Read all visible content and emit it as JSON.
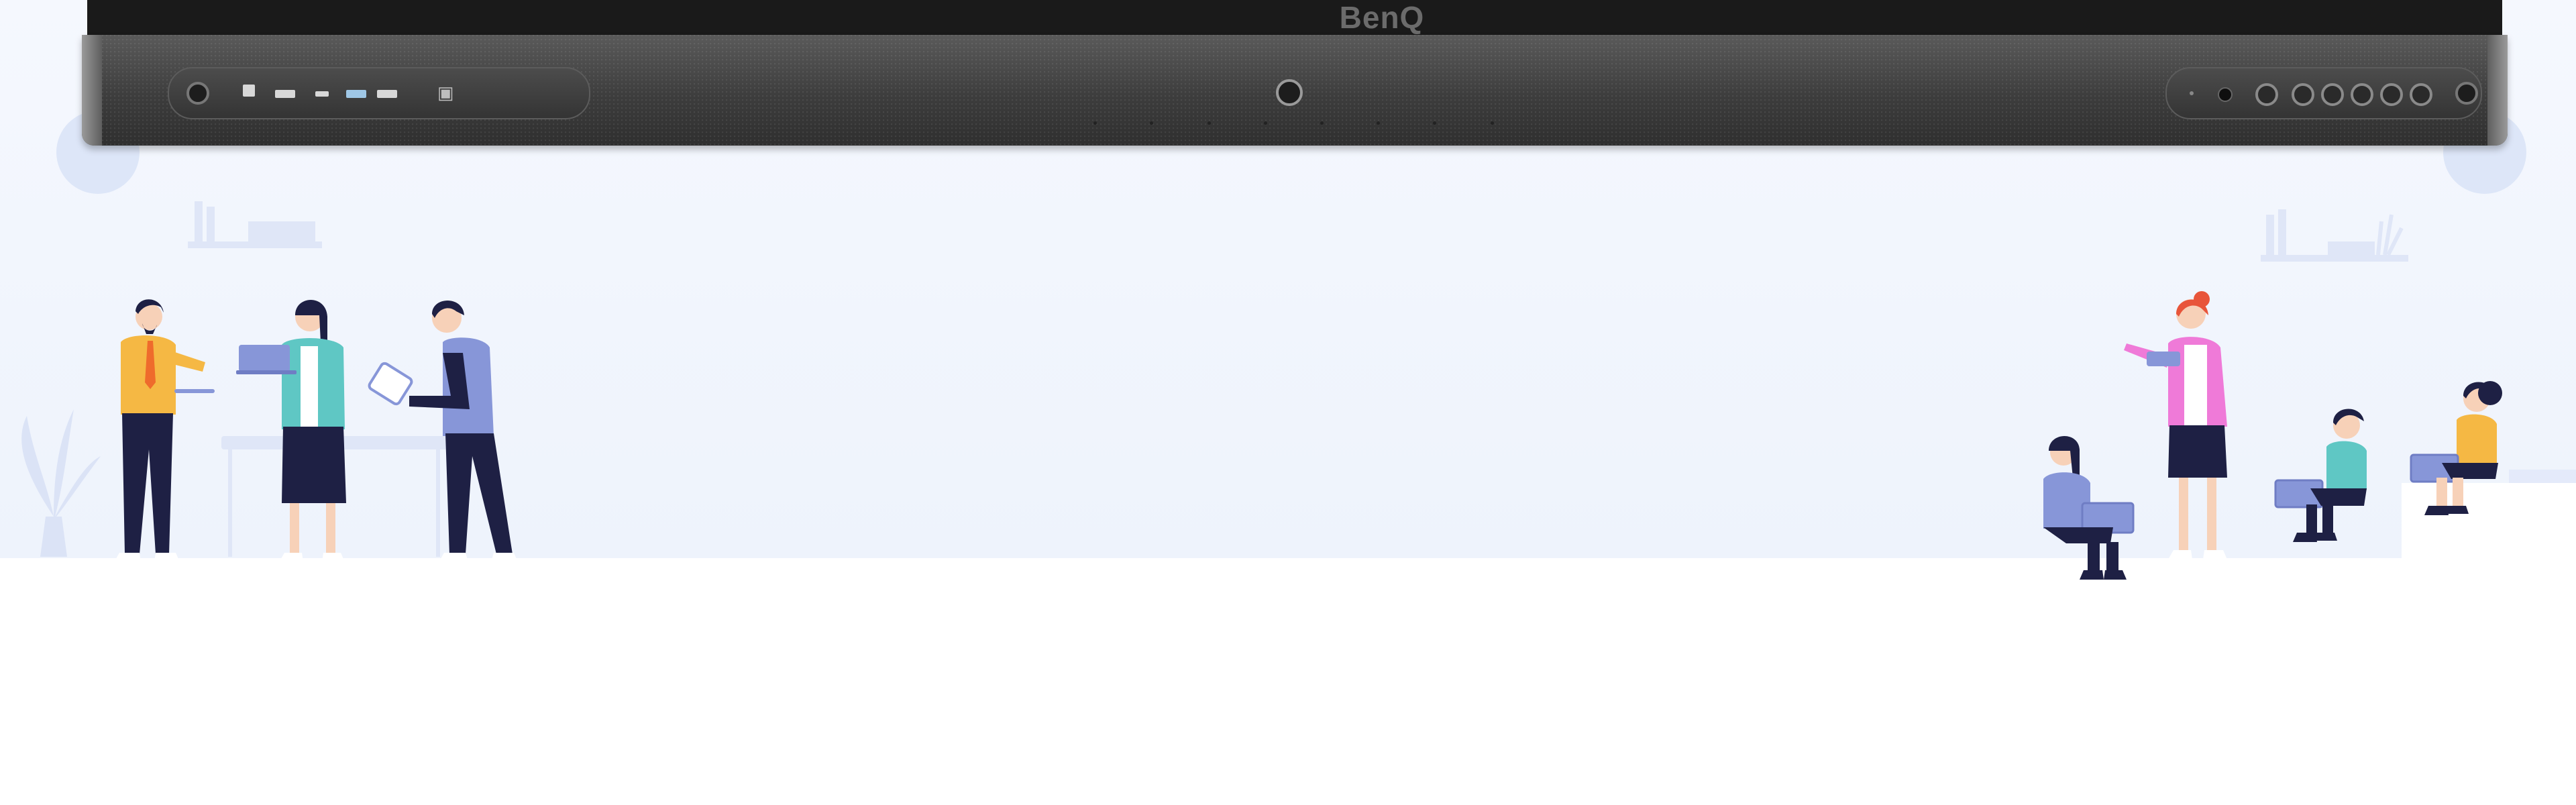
{
  "brand": {
    "logo_text": "BenQ"
  },
  "colors": {
    "background_top": "#f2f6fd",
    "background_bottom": "#ffffff",
    "bezel": "#1a1a1a",
    "speaker_bar": "#4a4a4a",
    "accent_blue": "#8796d8",
    "accent_orange": "#f5b844",
    "accent_teal": "#5fc7c4",
    "accent_pink": "#ef7ad8",
    "navy": "#1e2044"
  },
  "panel": {
    "left_ports": [
      "usb-b-port",
      "hdmi-port",
      "usb-c-port",
      "usb-a-port",
      "usb-a-port",
      "usb-a-port",
      "nfc-icon"
    ],
    "right_controls": [
      "power-indicator",
      "power-button",
      "button",
      "button",
      "button",
      "button",
      "button",
      "button"
    ],
    "center": "camera-knob"
  },
  "illustrations": {
    "left_group": [
      "man-with-tablet",
      "woman-with-laptop",
      "man-with-stylus-tablet"
    ],
    "right_group": [
      "seated-woman-with-laptop",
      "presenting-woman-with-tablet",
      "seated-boy-with-laptop",
      "seated-girl-with-laptop"
    ]
  }
}
